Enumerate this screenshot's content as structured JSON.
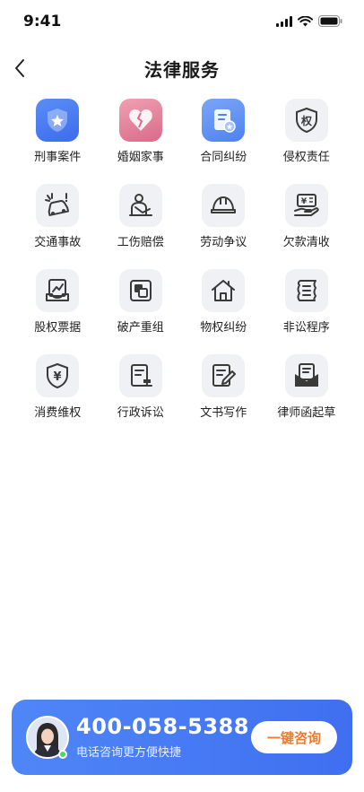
{
  "status_bar": {
    "time": "9:41",
    "icons": [
      "signal-icon",
      "wifi-icon",
      "battery-icon"
    ]
  },
  "header": {
    "title": "法律服务",
    "back_icon": "back-chevron-icon"
  },
  "services": [
    {
      "label": "刑事案件",
      "icon": "shield-star-icon"
    },
    {
      "label": "婚姻家事",
      "icon": "broken-heart-icon"
    },
    {
      "label": "合同纠纷",
      "icon": "contract-icon"
    },
    {
      "label": "侵权责任",
      "icon": "infringement-shield-icon"
    },
    {
      "label": "交通事故",
      "icon": "car-crash-icon"
    },
    {
      "label": "工伤赔偿",
      "icon": "injured-person-icon"
    },
    {
      "label": "劳动争议",
      "icon": "helmet-icon"
    },
    {
      "label": "欠款清收",
      "icon": "money-hand-icon"
    },
    {
      "label": "股权票据",
      "icon": "equity-chart-icon"
    },
    {
      "label": "破产重组",
      "icon": "restructure-icon"
    },
    {
      "label": "物权纠纷",
      "icon": "house-icon"
    },
    {
      "label": "非讼程序",
      "icon": "scroll-icon"
    },
    {
      "label": "消费维权",
      "icon": "yen-shield-icon"
    },
    {
      "label": "行政诉讼",
      "icon": "document-stamp-icon"
    },
    {
      "label": "文书写作",
      "icon": "document-pen-icon"
    },
    {
      "label": "律师函起草",
      "icon": "letter-icon"
    }
  ],
  "footer": {
    "phone": "400-058-5388",
    "subtitle": "电话咨询更方便快捷",
    "button_label": "一键咨询",
    "accent": "#4a7df5",
    "button_text_color": "#f07a2a"
  }
}
